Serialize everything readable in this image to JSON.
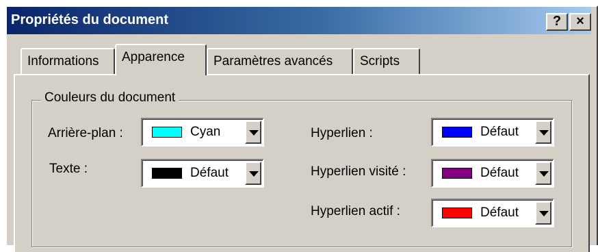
{
  "window": {
    "title": "Propriétés du document",
    "help_label": "?",
    "close_label": "×"
  },
  "tabs": [
    {
      "label": "Informations",
      "active": false
    },
    {
      "label": "Apparence",
      "active": true
    },
    {
      "label": "Paramètres avancés",
      "active": false
    },
    {
      "label": "Scripts",
      "active": false
    }
  ],
  "group": {
    "legend": "Couleurs du document"
  },
  "fields": {
    "background": {
      "label": "Arrière-plan :",
      "value": "Cyan",
      "color": "#00ffff"
    },
    "text": {
      "label": "Texte :",
      "value": "Défaut",
      "color": "#000000"
    },
    "link": {
      "label": "Hyperlien :",
      "value": "Défaut",
      "color": "#0000ff"
    },
    "visited": {
      "label": "Hyperlien visité :",
      "value": "Défaut",
      "color": "#800080"
    },
    "active": {
      "label": "Hyperlien actif :",
      "value": "Défaut",
      "color": "#ff0000"
    }
  }
}
